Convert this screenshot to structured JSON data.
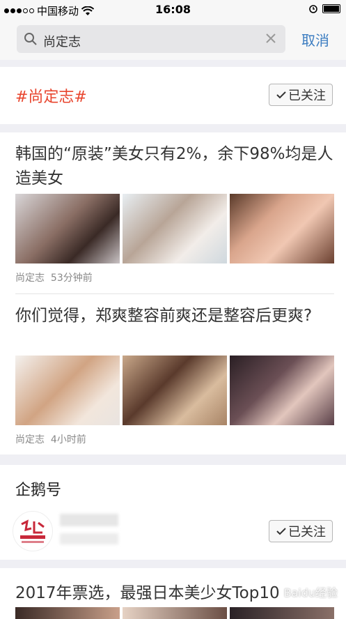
{
  "status_bar": {
    "carrier": "中国移动",
    "time": "16:08"
  },
  "search": {
    "query": "尚定志",
    "cancel_label": "取消"
  },
  "tag": {
    "label": "#尚定志#",
    "follow_label": "已关注"
  },
  "articles": [
    {
      "title": "韩国的“原装”美女只有2%，余下98%均是人造美女",
      "author": "尚定志",
      "time": "53分钟前"
    },
    {
      "title": "你们觉得，郑爽整容前爽还是整容后更爽?",
      "author": "尚定志",
      "time": "4小时前"
    }
  ],
  "qiehao": {
    "title": "企鹅号",
    "follow_label": "已关注"
  },
  "bottom_article": {
    "title": "2017年票选，最强日本美少女Top10"
  },
  "watermark": "Baidu经验",
  "colors": {
    "accent": "#3b7cc1",
    "tag": "#e8452e",
    "background": "#efeff4"
  }
}
